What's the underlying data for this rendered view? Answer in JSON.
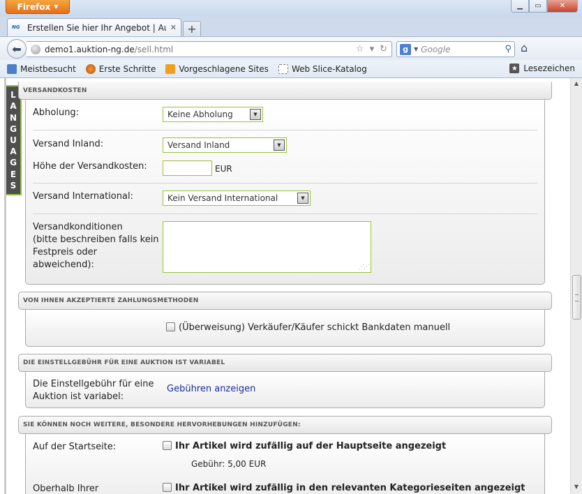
{
  "browser": {
    "menu_button": "Firefox",
    "tab_title": "Erstellen Sie hier Ihr Angebot | Auktion:N...",
    "tab_favicon": "NG",
    "url_domain": "demo1.auktion-ng.de",
    "url_path": "/sell.html",
    "search_placeholder": "Google",
    "bookmarks": [
      "Meistbesucht",
      "Erste Schritte",
      "Vorgeschlagene Sites",
      "Web Slice-Katalog"
    ],
    "bookmarks_right": "Lesezeichen"
  },
  "sidebar": {
    "languages_letters": [
      "L",
      "A",
      "N",
      "G",
      "U",
      "A",
      "G",
      "E",
      "S"
    ]
  },
  "versand": {
    "header": "VERSANDKOSTEN",
    "abholung_label": "Abholung:",
    "abholung_value": "Keine Abholung",
    "inland_label": "Versand Inland:",
    "inland_value": "Versand Inland",
    "hoehe_label": "Höhe der Versandkosten:",
    "currency": "EUR",
    "international_label": "Versand International:",
    "international_value": "Kein Versand International",
    "konditionen_lines": [
      "Versandkonditionen",
      "(bitte beschreiben falls kein",
      "Festpreis oder",
      "abweichend):"
    ]
  },
  "zahlung": {
    "header": "VON IHNEN AKZEPTIERTE ZAHLUNGSMETHODEN",
    "option": "(Überweisung) Verkäufer/Käufer schickt Bankdaten manuell"
  },
  "gebuehr": {
    "header": "DIE EINSTELLGEBÜHR FÜR EINE AUKTION IST VARIABEL",
    "text_lines": [
      "Die Einstellgebühr für eine",
      "Auktion ist variabel:"
    ],
    "link": "Gebühren anzeigen"
  },
  "hervorhebung": {
    "header": "SIE KÖNNEN NOCH WEITERE, BESONDERE HERVORHEBUNGEN HINZUFÜGEN:",
    "startseite_label": "Auf der Startseite:",
    "startseite_option": "Ihr Artikel wird zufällig auf der Hauptseite angezeigt",
    "startseite_fee": "Gebühr: 5,00 EUR",
    "kategorie_label": "Oberhalb Ihrer",
    "kategorie_option": "Ihr Artikel wird zufällig in den relevanten Kategorieseiten angezeigt"
  }
}
